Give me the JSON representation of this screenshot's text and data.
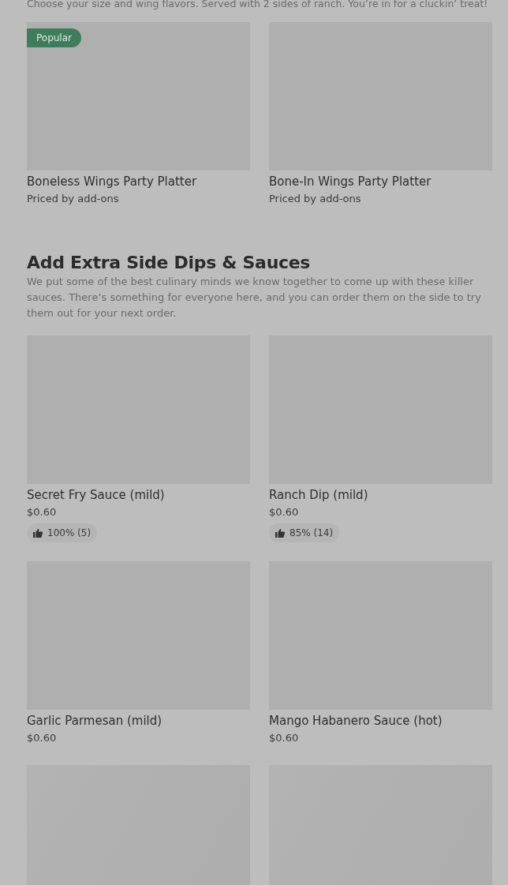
{
  "intro": {
    "description": "Choose your size and wing flavors. Served with 2 sides of ranch. You’re in for a cluckin’ treat!",
    "items": [
      {
        "kind": "item",
        "name": "Boneless Wings Party Platter",
        "subtitle": "Priced by add-ons",
        "badge": "Popular"
      },
      {
        "kind": "item",
        "name": "Bone-In Wings Party Platter",
        "subtitle": "Priced by add-ons"
      }
    ]
  },
  "section": {
    "title": "Add Extra Side Dips & Sauces",
    "description": "We put some of the best culinary minds we know together to come up with these killer sauces. There’s something for everyone here, and you can order them on the side to try them out for your next order.",
    "items": [
      {
        "kind": "item",
        "name": "Secret Fry Sauce (mild)",
        "subtitle": "$0.60",
        "rating": "100% (5)"
      },
      {
        "kind": "item",
        "name": "Ranch Dip (mild)",
        "subtitle": "$0.60",
        "rating": "85% (14)"
      },
      {
        "kind": "item",
        "name": "Garlic Parmesan (mild)",
        "subtitle": "$0.60"
      },
      {
        "kind": "item",
        "name": "Mango Habanero Sauce (hot)",
        "subtitle": "$0.60"
      },
      {
        "kind": "image-only"
      },
      {
        "kind": "image-only"
      }
    ]
  }
}
